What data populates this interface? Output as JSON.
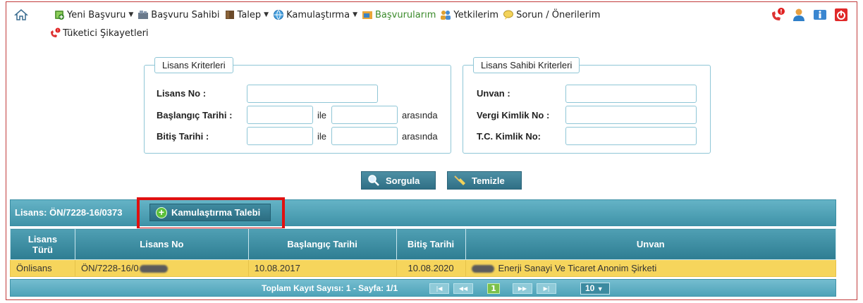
{
  "nav": {
    "items": [
      {
        "label": "Yeni Başvuru",
        "icon": "new-application-icon",
        "dropdown": true
      },
      {
        "label": "Başvuru Sahibi",
        "icon": "applicant-icon",
        "dropdown": false
      },
      {
        "label": "Talep",
        "icon": "request-icon",
        "dropdown": true
      },
      {
        "label": "Kamulaştırma",
        "icon": "globe-icon",
        "dropdown": true
      },
      {
        "label": "Başvurularım",
        "icon": "applications-icon",
        "dropdown": false,
        "active": true
      },
      {
        "label": "Yetkilerim",
        "icon": "users-icon",
        "dropdown": false
      },
      {
        "label": "Sorun / Önerilerim",
        "icon": "speech-bubble-icon",
        "dropdown": false
      }
    ],
    "row2_item": {
      "label": "Tüketici Şikayetleri",
      "icon": "phone-alert-icon"
    },
    "right_icons": [
      "phone-alert-icon",
      "user-icon",
      "info-icon",
      "power-icon"
    ]
  },
  "license_criteria": {
    "legend": "Lisans Kriterleri",
    "license_no_label": "Lisans No :",
    "start_date_label": "Başlangıç Tarihi :",
    "end_date_label": "Bitiş Tarihi :",
    "between_and": "ile",
    "between_suffix": "arasında"
  },
  "owner_criteria": {
    "legend": "Lisans Sahibi Kriterleri",
    "title_label": "Unvan :",
    "tax_no_label": "Vergi Kimlik No :",
    "tc_no_label": "T.C. Kimlik No:"
  },
  "buttons": {
    "query": "Sorgula",
    "clear": "Temizle",
    "expropriation_request": "Kamulaştırma Talebi"
  },
  "result": {
    "title": "Lisans: ÖN/7228-16/037",
    "title_tail": "3"
  },
  "table": {
    "headers": [
      "Lisans Türü",
      "Lisans No",
      "Başlangıç Tarihi",
      "Bitiş Tarihi",
      "Unvan"
    ],
    "header_type_line1": "Lisans",
    "header_type_line2": "Türü",
    "row": {
      "type": "Önlisans",
      "license_no": "ÖN/7228-16/0",
      "start_date": "10.08.2017",
      "end_date": "10.08.2020",
      "title": "Enerji Sanayi Ve Ticaret Anonim Şirketi"
    }
  },
  "pager": {
    "summary": "Toplam Kayıt Sayısı: 1 - Sayfa: 1/1",
    "current_page": "1",
    "page_size": "10"
  },
  "colors": {
    "accent": "#3f93a8",
    "row_highlight": "#f6d55c",
    "annotation": "#e01010"
  }
}
